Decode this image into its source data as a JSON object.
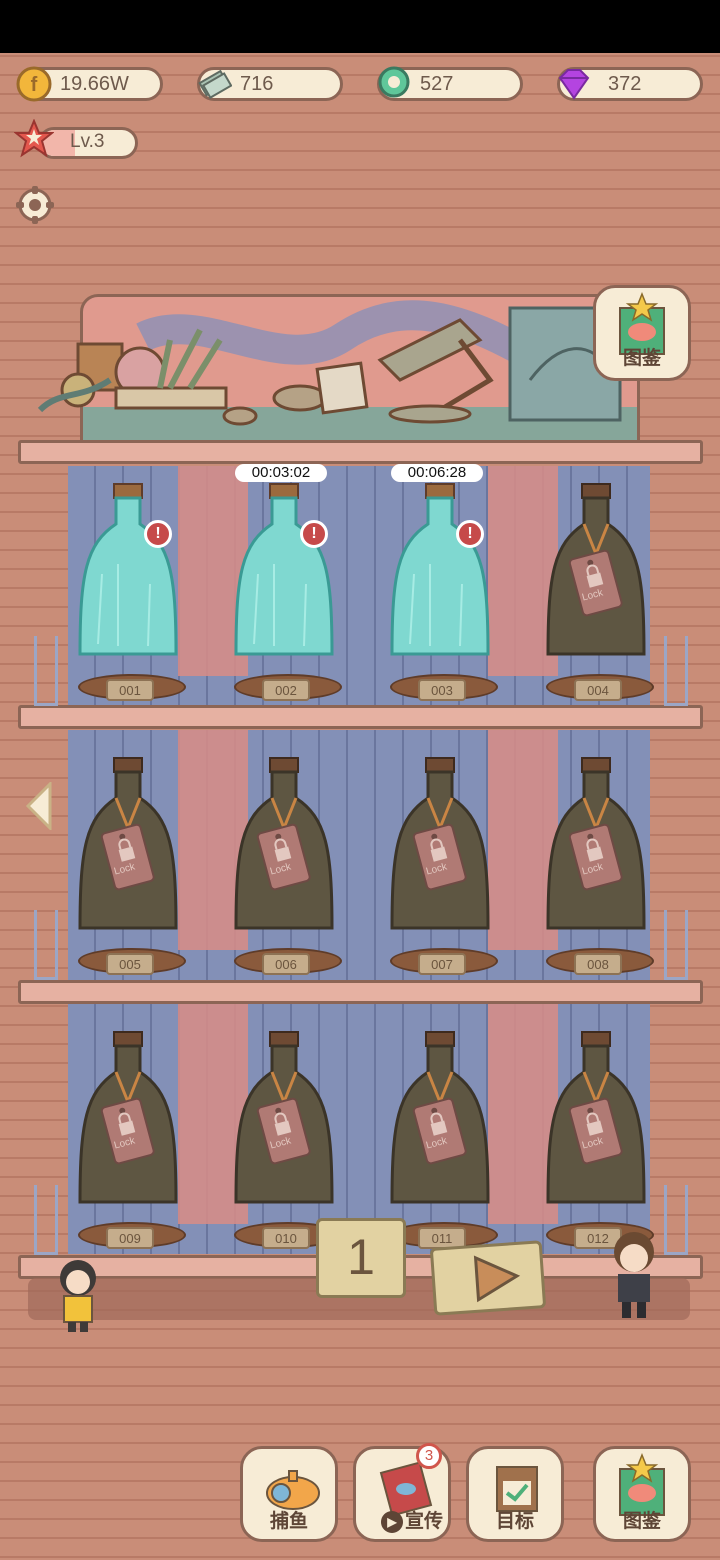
{
  "currencies": {
    "gold": {
      "value": "19.66W",
      "icon": "gold-coin-icon",
      "color": "#f2b63b"
    },
    "cash": {
      "value": "716",
      "icon": "cash-stack-icon",
      "color": "#9fb8a8"
    },
    "pearl": {
      "value": "527",
      "icon": "green-gem-icon",
      "color": "#5fc79a"
    },
    "diamond": {
      "value": "372",
      "icon": "purple-diamond-icon",
      "color": "#b444e0"
    }
  },
  "level": {
    "label": "Lv.3"
  },
  "collection_label": "图鉴",
  "bottles": [
    {
      "number": "001",
      "state": "ready",
      "timer": ""
    },
    {
      "number": "002",
      "state": "ready",
      "timer": "00:03:02"
    },
    {
      "number": "003",
      "state": "ready",
      "timer": "00:06:28"
    },
    {
      "number": "004",
      "state": "locked",
      "lock_text": "Lock"
    },
    {
      "number": "005",
      "state": "locked",
      "lock_text": "Lock"
    },
    {
      "number": "006",
      "state": "locked",
      "lock_text": "Lock"
    },
    {
      "number": "007",
      "state": "locked",
      "lock_text": "Lock"
    },
    {
      "number": "008",
      "state": "locked",
      "lock_text": "Lock"
    },
    {
      "number": "009",
      "state": "locked",
      "lock_text": "Lock"
    },
    {
      "number": "010",
      "state": "locked",
      "lock_text": "Lock"
    },
    {
      "number": "011",
      "state": "locked",
      "lock_text": "Lock"
    },
    {
      "number": "012",
      "state": "locked",
      "lock_text": "Lock"
    }
  ],
  "page_indicator": "1",
  "bottom_nav": [
    {
      "label": "捕鱼",
      "icon": "submarine-icon"
    },
    {
      "label": "宣传",
      "icon": "promo-card-icon",
      "badge": "3"
    },
    {
      "label": "目标",
      "icon": "target-board-icon"
    },
    {
      "label": "图鉴",
      "icon": "fish-book-icon"
    }
  ],
  "colors": {
    "glass": "#7fd8d0",
    "locked_glass": "#5e5642",
    "alert": "#c64a4a"
  }
}
